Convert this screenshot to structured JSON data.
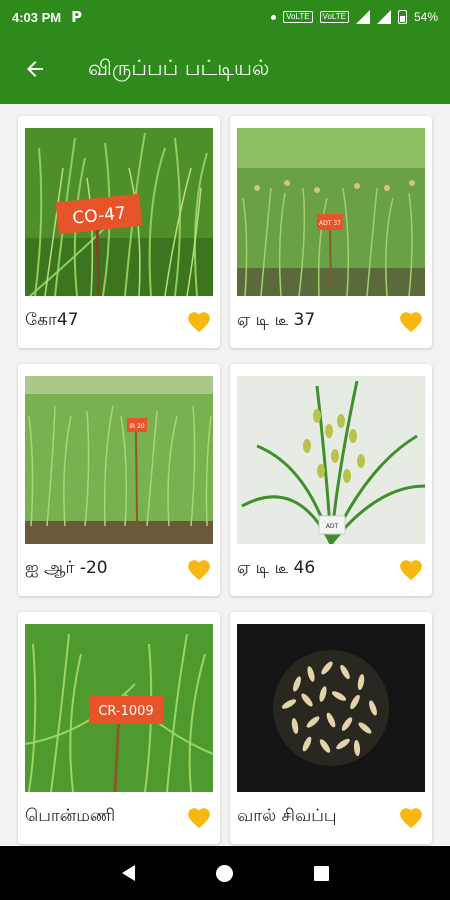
{
  "status_bar": {
    "time": "4:03 PM",
    "app_icon": "P",
    "volte1": "VoLTE",
    "volte2": "VoLTE",
    "battery": "54%"
  },
  "header": {
    "back_icon": "arrow-left-icon",
    "title": "விருப்பப் பட்டியல்"
  },
  "items": [
    {
      "name": "கோ47",
      "tag": "CO-47"
    },
    {
      "name": "ஏ டி டீ 37",
      "tag": "ADT 37"
    },
    {
      "name": "ஐ ஆர் -20",
      "tag": "IR 20"
    },
    {
      "name": "ஏ டி டீ 46",
      "tag": "ADT"
    },
    {
      "name": "பொன்மணி",
      "tag": "CR-1009"
    },
    {
      "name": "வால் சிவப்பு",
      "tag": ""
    }
  ],
  "colors": {
    "primary": "#2f8a1c",
    "heart": "#f7b90f"
  }
}
